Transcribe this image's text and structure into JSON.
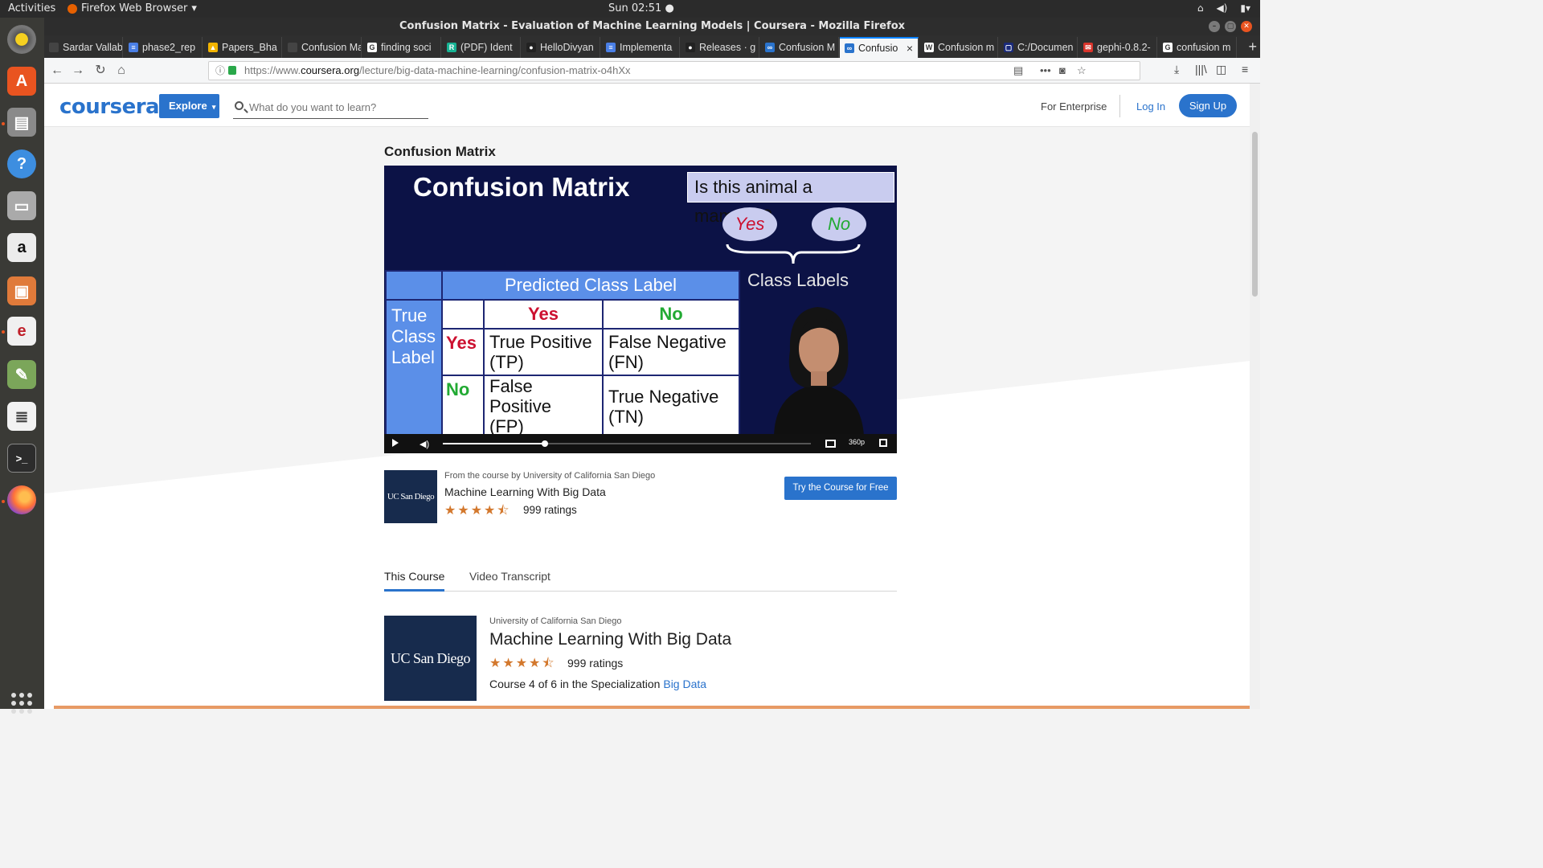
{
  "desktop": {
    "activities": "Activities",
    "app_menu": "Firefox Web Browser",
    "clock": "Sun 02:51",
    "dock": [
      "rhythmbox-icon",
      "software-center-icon",
      "files-drawer-icon",
      "help-icon",
      "scanner-icon",
      "amazon-icon",
      "photo-app-icon",
      "pdf-viewer-icon",
      "draw-icon",
      "text-editor-icon",
      "terminal-icon",
      "firefox-icon"
    ]
  },
  "window": {
    "title": "Confusion Matrix - Evaluation of Machine Learning Models | Coursera - Mozilla Firefox"
  },
  "tabs": [
    {
      "label": "Sardar Vallabh",
      "fav_color": "#444444",
      "fav": ""
    },
    {
      "label": "phase2_rep",
      "fav_color": "#4a7fe6",
      "fav": "≡"
    },
    {
      "label": "Papers_Bha",
      "fav_color": "#f2b400",
      "fav": "▲"
    },
    {
      "label": "Confusion Mat",
      "fav_color": "#444444",
      "fav": ""
    },
    {
      "label": "finding soci",
      "fav_color": "#ffffff",
      "fav": "G"
    },
    {
      "label": "(PDF) Ident",
      "fav_color": "#17b394",
      "fav": "R"
    },
    {
      "label": "HelloDivyan",
      "fav_color": "#222222",
      "fav": "●"
    },
    {
      "label": "Implementa",
      "fav_color": "#4a7fe6",
      "fav": "≡"
    },
    {
      "label": "Releases · g",
      "fav_color": "#222222",
      "fav": "●"
    },
    {
      "label": "Confusion M",
      "fav_color": "#2a73cc",
      "fav": "∞"
    },
    {
      "label": "Confusio",
      "fav_color": "#2a73cc",
      "fav": "∞",
      "active": true
    },
    {
      "label": "Confusion m",
      "fav_color": "#ffffff",
      "fav": "W"
    },
    {
      "label": "C:/Documen",
      "fav_color": "#1a2a7a",
      "fav": "▢"
    },
    {
      "label": "gephi-0.8.2-",
      "fav_color": "#d9342b",
      "fav": "✉"
    },
    {
      "label": "confusion m",
      "fav_color": "#ffffff",
      "fav": "G"
    }
  ],
  "url": {
    "scheme": "https://www.",
    "host": "coursera.org",
    "path": "/lecture/big-data-machine-learning/confusion-matrix-o4hXx"
  },
  "header": {
    "logo": "coursera",
    "explore": "Explore",
    "search_placeholder": "What do you want to learn?",
    "for_enterprise": "For Enterprise",
    "log_in": "Log In",
    "sign_up": "Sign Up"
  },
  "lecture": {
    "title": "Confusion Matrix"
  },
  "slide": {
    "title": "Confusion Matrix",
    "question": "Is this animal a mammal?",
    "label_yes": "Yes",
    "label_no": "No",
    "class_labels": "Class Labels",
    "predicted_header": "Predicted Class Label",
    "true_class_label": [
      "True",
      "Class",
      "Label"
    ],
    "cells": {
      "tp": [
        "True Positive",
        "(TP)"
      ],
      "fn": [
        "False Negative",
        "(FN)"
      ],
      "fp": [
        "False Positive",
        "(FP)"
      ],
      "tn": [
        "True Negative",
        "(TN)"
      ]
    },
    "colors": {
      "yes": "#cc1030",
      "no": "#22aa33"
    }
  },
  "player": {
    "progress": 0.277,
    "quality": "360p"
  },
  "course": {
    "from_line": "From the course by University of California San Diego",
    "name": "Machine Learning With Big Data",
    "rating_stars": 4.5,
    "ratings": "999 ratings",
    "try_button": "Try the Course for Free",
    "logo_text": "UC San Diego"
  },
  "page_tabs": {
    "this_course": "This Course",
    "video_transcript": "Video Transcript"
  },
  "course_card": {
    "university": "University of California San Diego",
    "name": "Machine Learning With Big Data",
    "ratings": "999 ratings",
    "spec_prefix": "Course 4 of 6 in the Specialization",
    "spec_link": "Big Data"
  }
}
